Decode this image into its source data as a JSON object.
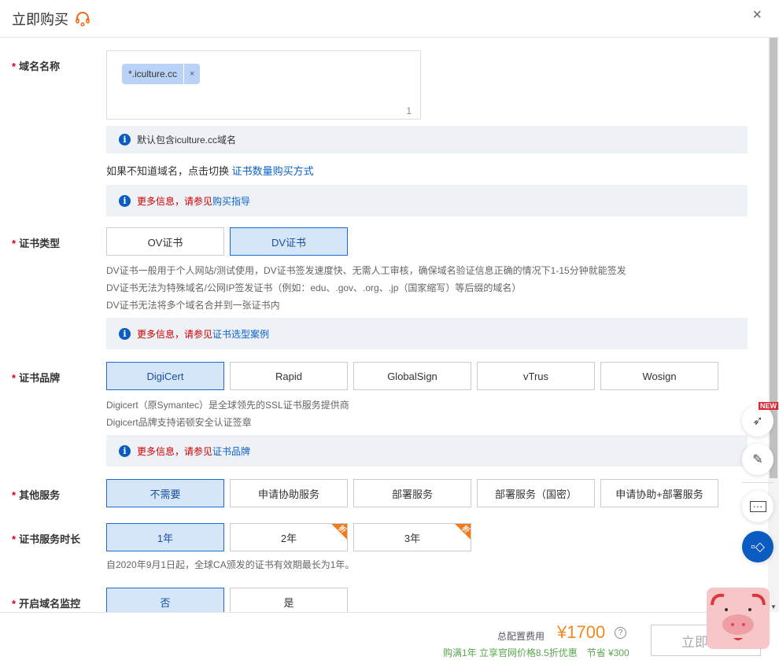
{
  "header": {
    "title": "立即购买",
    "close": "×"
  },
  "domain": {
    "label": "域名名称",
    "tag": "*.iculture.cc",
    "tag_remove": "×",
    "count": "1",
    "info": "默认包含iculture.cc域名",
    "switch_text": "如果不知道域名，点击切换 ",
    "switch_link": "证书数量购买方式",
    "more_red": "更多信息，请参见",
    "more_link": "购买指导"
  },
  "cert_type": {
    "label": "证书类型",
    "options": [
      "OV证书",
      "DV证书"
    ],
    "selected": "DV证书",
    "desc": [
      "DV证书一般用于个人网站/测试使用，DV证书签发速度快、无需人工审核，确保域名验证信息正确的情况下1-15分钟就能签发",
      "DV证书无法为特殊域名/公网IP签发证书（例如：edu、.gov、.org、.jp（国家缩写）等后缀的域名）",
      "DV证书无法将多个域名合并到一张证书内"
    ],
    "more_red": "更多信息，请参见",
    "more_link": "证书选型案例"
  },
  "brand": {
    "label": "证书品牌",
    "options": [
      "DigiCert",
      "Rapid",
      "GlobalSign",
      "vTrus",
      "Wosign"
    ],
    "selected": "DigiCert",
    "desc": [
      "Digicert（原Symantec）是全球领先的SSL证书服务提供商",
      "Digicert品牌支持诺顿安全认证签章"
    ],
    "more_red": "更多信息，请参见",
    "more_link": "证书品牌"
  },
  "service": {
    "label": "其他服务",
    "options": [
      "不需要",
      "申请协助服务",
      "部署服务",
      "部署服务（国密）",
      "申请协助+部署服务"
    ],
    "selected": "不需要"
  },
  "duration": {
    "label": "证书服务时长",
    "options": [
      "1年",
      "2年",
      "3年"
    ],
    "selected": "1年",
    "discount_badge": "折",
    "note": "自2020年9月1日起，全球CA颁发的证书有效期最长为1年。"
  },
  "monitor": {
    "label": "开启域名监控",
    "options": [
      "否",
      "是"
    ],
    "selected": "否"
  },
  "footer": {
    "total_label": "总配置费用",
    "price": "¥1700",
    "help": "?",
    "promo": "购满1年 立享官网价格8.5折优惠　节省 ¥300",
    "buy": "立即购买"
  },
  "floating": {
    "new_badge": "NEW"
  },
  "colors": {
    "accent": "#1c6bd1",
    "price": "#f28a20",
    "required": "#d9001b"
  }
}
